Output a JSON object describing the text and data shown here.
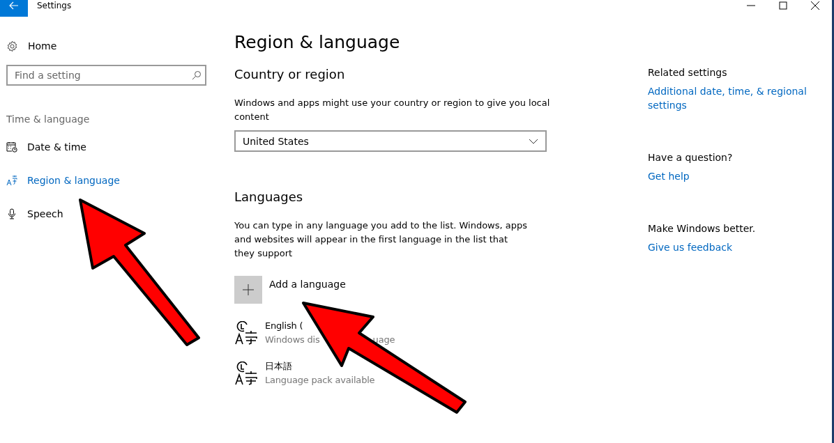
{
  "window": {
    "title": "Settings"
  },
  "sidebar": {
    "home": "Home",
    "search": {
      "placeholder": "Find a setting"
    },
    "group": "Time & language",
    "items": [
      {
        "label": "Date & time",
        "selected": false
      },
      {
        "label": "Region & language",
        "selected": true
      },
      {
        "label": "Speech",
        "selected": false
      }
    ]
  },
  "page": {
    "title": "Region & language",
    "country_heading": "Country or region",
    "country_text": "Windows and apps might use your country or region to give you local content",
    "country_value": "United States",
    "languages_heading": "Languages",
    "languages_text": "You can type in any language you add to the list. Windows, apps and websites will appear in the first language in the list that they support",
    "add_language": "Add a language",
    "languages": [
      {
        "name": "English (",
        "status": "Windows dis",
        "status_end": "uage"
      },
      {
        "name": "日本語",
        "status": "Language pack available"
      }
    ]
  },
  "related": {
    "heading": "Related settings",
    "link": "Additional date, time, & regional settings",
    "question": "Have a question?",
    "help": "Get help",
    "better": "Make Windows better.",
    "feedback": "Give us feedback"
  }
}
